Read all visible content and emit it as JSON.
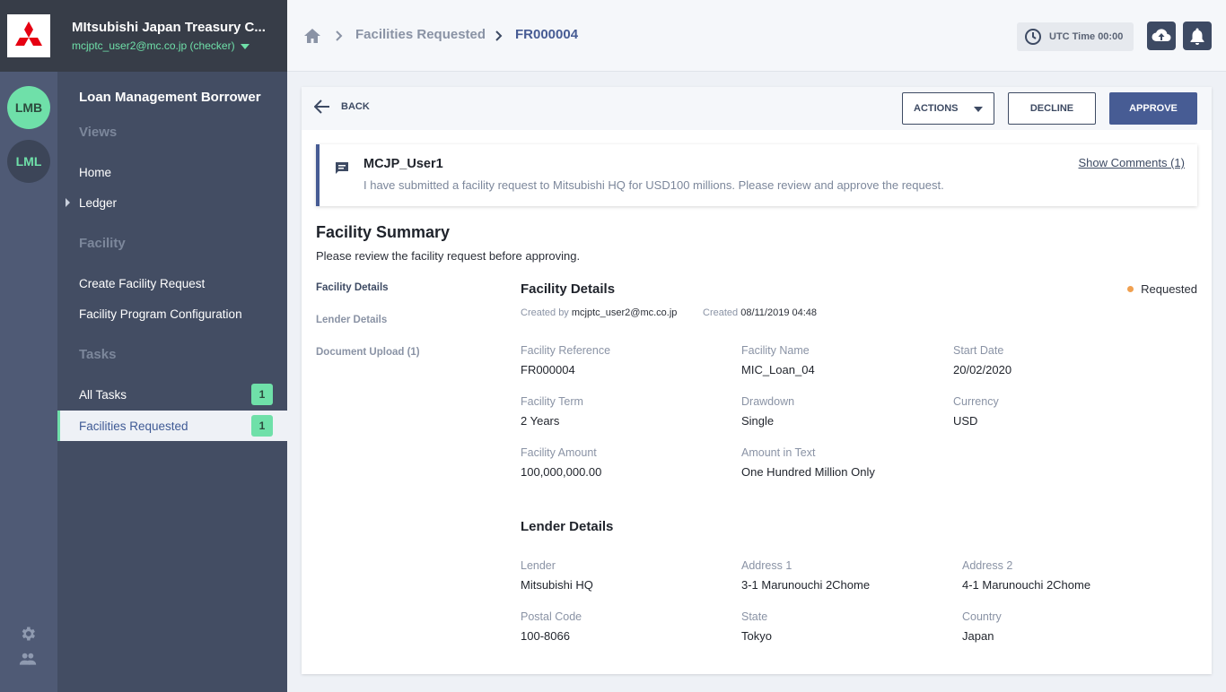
{
  "brand": {
    "org_name": "MItsubishi Japan Treasury C...",
    "user": "mcjptc_user2@mc.co.jp (checker)"
  },
  "rail": {
    "apps": [
      "LMB",
      "LML"
    ]
  },
  "sidebar": {
    "module_title": "Loan Management Borrower",
    "views_label": "Views",
    "home": "Home",
    "ledger": "Ledger",
    "facility_label": "Facility",
    "create_facility_request": "Create Facility Request",
    "facility_program_configuration": "Facility Program Configuration",
    "tasks_label": "Tasks",
    "all_tasks": "All Tasks",
    "all_tasks_count": "1",
    "facilities_requested": "Facilities Requested",
    "facilities_requested_count": "1"
  },
  "topbar": {
    "breadcrumb_parent": "Facilities Requested",
    "breadcrumb_current": "FR000004",
    "utc_time": "UTC Time 00:00"
  },
  "toolbar": {
    "back": "BACK",
    "actions": "ACTIONS",
    "decline": "DECLINE",
    "approve": "APPROVE"
  },
  "comment": {
    "user": "MCJP_User1",
    "text": "I have submitted a facility request to Mitsubishi HQ for USD100 millions. Please review and approve the request.",
    "show_comments": "Show Comments (1)"
  },
  "summary": {
    "title": "Facility Summary",
    "subtitle": "Please review the facility request before approving.",
    "nav": [
      "Facility Details",
      "Lender Details",
      "Document Upload (1)"
    ]
  },
  "facility_details": {
    "title": "Facility Details",
    "status": "Requested",
    "created_by_label": "Created by",
    "created_by": "mcjptc_user2@mc.co.jp",
    "created_label": "Created",
    "created": "08/11/2019 04:48",
    "fields": [
      {
        "label": "Facility Reference",
        "value": "FR000004"
      },
      {
        "label": "Facility Name",
        "value": "MIC_Loan_04"
      },
      {
        "label": "Start Date",
        "value": "20/02/2020"
      },
      {
        "label": "Facility Term",
        "value": "2 Years"
      },
      {
        "label": "Drawdown",
        "value": "Single"
      },
      {
        "label": "Currency",
        "value": "USD"
      },
      {
        "label": "Facility Amount",
        "value": "100,000,000.00"
      },
      {
        "label": "Amount in Text",
        "value": "One Hundred Million Only"
      }
    ]
  },
  "lender_details": {
    "title": "Lender Details",
    "fields": [
      {
        "label": "Lender",
        "value": "Mitsubishi HQ"
      },
      {
        "label": "Address 1",
        "value": "3-1 Marunouchi 2Chome"
      },
      {
        "label": "Address 2",
        "value": "4-1 Marunouchi 2Chome"
      },
      {
        "label": "Postal Code",
        "value": "100-8066"
      },
      {
        "label": "State",
        "value": "Tokyo"
      },
      {
        "label": "Country",
        "value": "Japan"
      }
    ]
  },
  "colors": {
    "accent_green": "#6fe0a9",
    "primary_blue": "#475c94",
    "status_requested": "#f0a050"
  }
}
